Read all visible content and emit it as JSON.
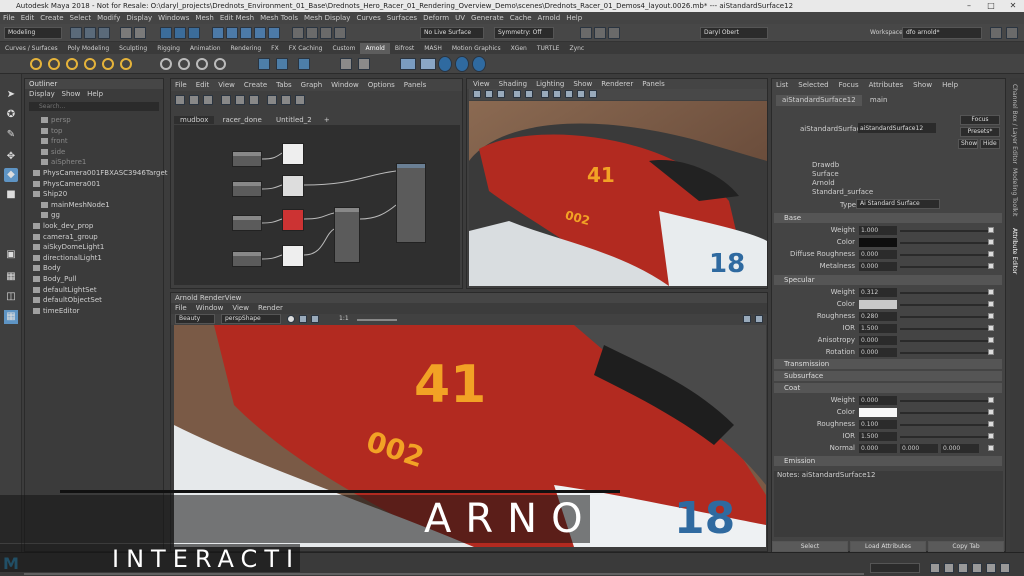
{
  "titlebar": {
    "text": "Autodesk Maya 2018 - Not for Resale: O:\\daryl_projects\\Drednots_Environment_01_Base\\Drednots_Hero_Racer_01_Rendering_Overview_Demo\\scenes\\Drednots_Racer_01_Demos4_layout.0026.mb* --- aiStandardSurface12"
  },
  "menubar": [
    "File",
    "Edit",
    "Create",
    "Select",
    "Modify",
    "Display",
    "Windows",
    "Mesh",
    "Edit Mesh",
    "Mesh Tools",
    "Mesh Display",
    "Curves",
    "Surfaces",
    "Deform",
    "UV",
    "Generate",
    "Cache",
    "Arnold",
    "Help"
  ],
  "statusline": {
    "mode": "Modeling",
    "live_surface": "No Live Surface",
    "symmetry": "Symmetry: Off",
    "user": "Daryl Obert"
  },
  "workspace": {
    "label": "Workspace :",
    "value": "dfo arnold*"
  },
  "shelf_tabs": [
    "Curves / Surfaces",
    "Poly Modeling",
    "Sculpting",
    "Rigging",
    "Animation",
    "Rendering",
    "FX",
    "FX Caching",
    "Custom",
    "Arnold",
    "Bifrost",
    "MASH",
    "Motion Graphics",
    "XGen",
    "TURTLE",
    "Zync"
  ],
  "active_shelf": "Arnold",
  "outliner": {
    "title": "Outliner",
    "menu": [
      "Display",
      "Show",
      "Help"
    ],
    "search_placeholder": "Search...",
    "items": [
      "persp",
      "top",
      "front",
      "side",
      "aiSphere1",
      "PhysCamera001FBXASC3946Target",
      "PhysCamera001",
      "Ship20",
      "mainMeshNode1",
      "gg",
      "look_dev_prop",
      "camera1_group",
      "aiSkyDomeLight1",
      "directionalLight1",
      "Body",
      "Body_Pull",
      "defaultLightSet",
      "defaultObjectSet",
      "timeEditor"
    ]
  },
  "hypershade": {
    "menu": [
      "File",
      "Edit",
      "View",
      "Create",
      "Tabs",
      "Graph",
      "Window",
      "Options",
      "Panels"
    ],
    "tabs": [
      "mudbox",
      "racer_done",
      "Untitled_2",
      "+"
    ]
  },
  "viewport": {
    "menu": [
      "View",
      "Shading",
      "Lighting",
      "Show",
      "Renderer",
      "Panels"
    ]
  },
  "renderview": {
    "title": "Arnold RenderView",
    "menu": [
      "File",
      "Window",
      "View",
      "Render"
    ],
    "aov": "Beauty",
    "camera": "perspShape",
    "zoom": "1:1"
  },
  "attribute_editor": {
    "menu": [
      "List",
      "Selected",
      "Focus",
      "Attributes",
      "Show",
      "Help"
    ],
    "tabs": [
      "aiStandardSurface12",
      "main"
    ],
    "node_label": "aiStandardSurface:",
    "node_name": "aiStandardSurface12",
    "focus": "Focus",
    "presets": "Presets*",
    "show": "Show",
    "hide": "Hide",
    "renderers": [
      "Drawdb",
      "Surface",
      "Arnold",
      "Standard_surface"
    ],
    "type_label": "Type",
    "type_value": "Ai Standard Surface",
    "sections": {
      "base": "Base",
      "specular": "Specular",
      "transmission": "Transmission",
      "subsurface": "Subsurface",
      "coat": "Coat",
      "emission": "Emission"
    },
    "base": [
      {
        "label": "Weight",
        "value": "1.000"
      },
      {
        "label": "Color",
        "value": ""
      },
      {
        "label": "Diffuse Roughness",
        "value": "0.000"
      },
      {
        "label": "Metalness",
        "value": "0.000"
      }
    ],
    "specular": [
      {
        "label": "Weight",
        "value": "0.312"
      },
      {
        "label": "Color",
        "value": ""
      },
      {
        "label": "Roughness",
        "value": "0.280"
      },
      {
        "label": "IOR",
        "value": "1.500"
      },
      {
        "label": "Anisotropy",
        "value": "0.000"
      },
      {
        "label": "Rotation",
        "value": "0.000"
      }
    ],
    "coat": [
      {
        "label": "Weight",
        "value": "0.000"
      },
      {
        "label": "Color",
        "value": ""
      },
      {
        "label": "Roughness",
        "value": "0.100"
      },
      {
        "label": "IOR",
        "value": "1.500"
      },
      {
        "label": "Normal",
        "value": "0.000",
        "v2": "0.000",
        "v3": "0.000"
      }
    ],
    "notes": "Notes: aiStandardSurface12",
    "buttons": [
      "Select",
      "Load Attributes",
      "Copy Tab"
    ]
  },
  "right_strip": [
    "Channel Box / Layer Editor",
    "Modeling Toolkit",
    "Attribute Editor"
  ],
  "overlay": {
    "line1": "ARNO",
    "line2": "INTERACTI"
  },
  "race_numbers": {
    "spade": "41",
    "nose": "002",
    "side": "18"
  },
  "colors": {
    "accent": "#5e94c4",
    "shelf_icon": "#e5b33a",
    "car_red": "#b22a20",
    "car_orange": "#f2a225"
  }
}
